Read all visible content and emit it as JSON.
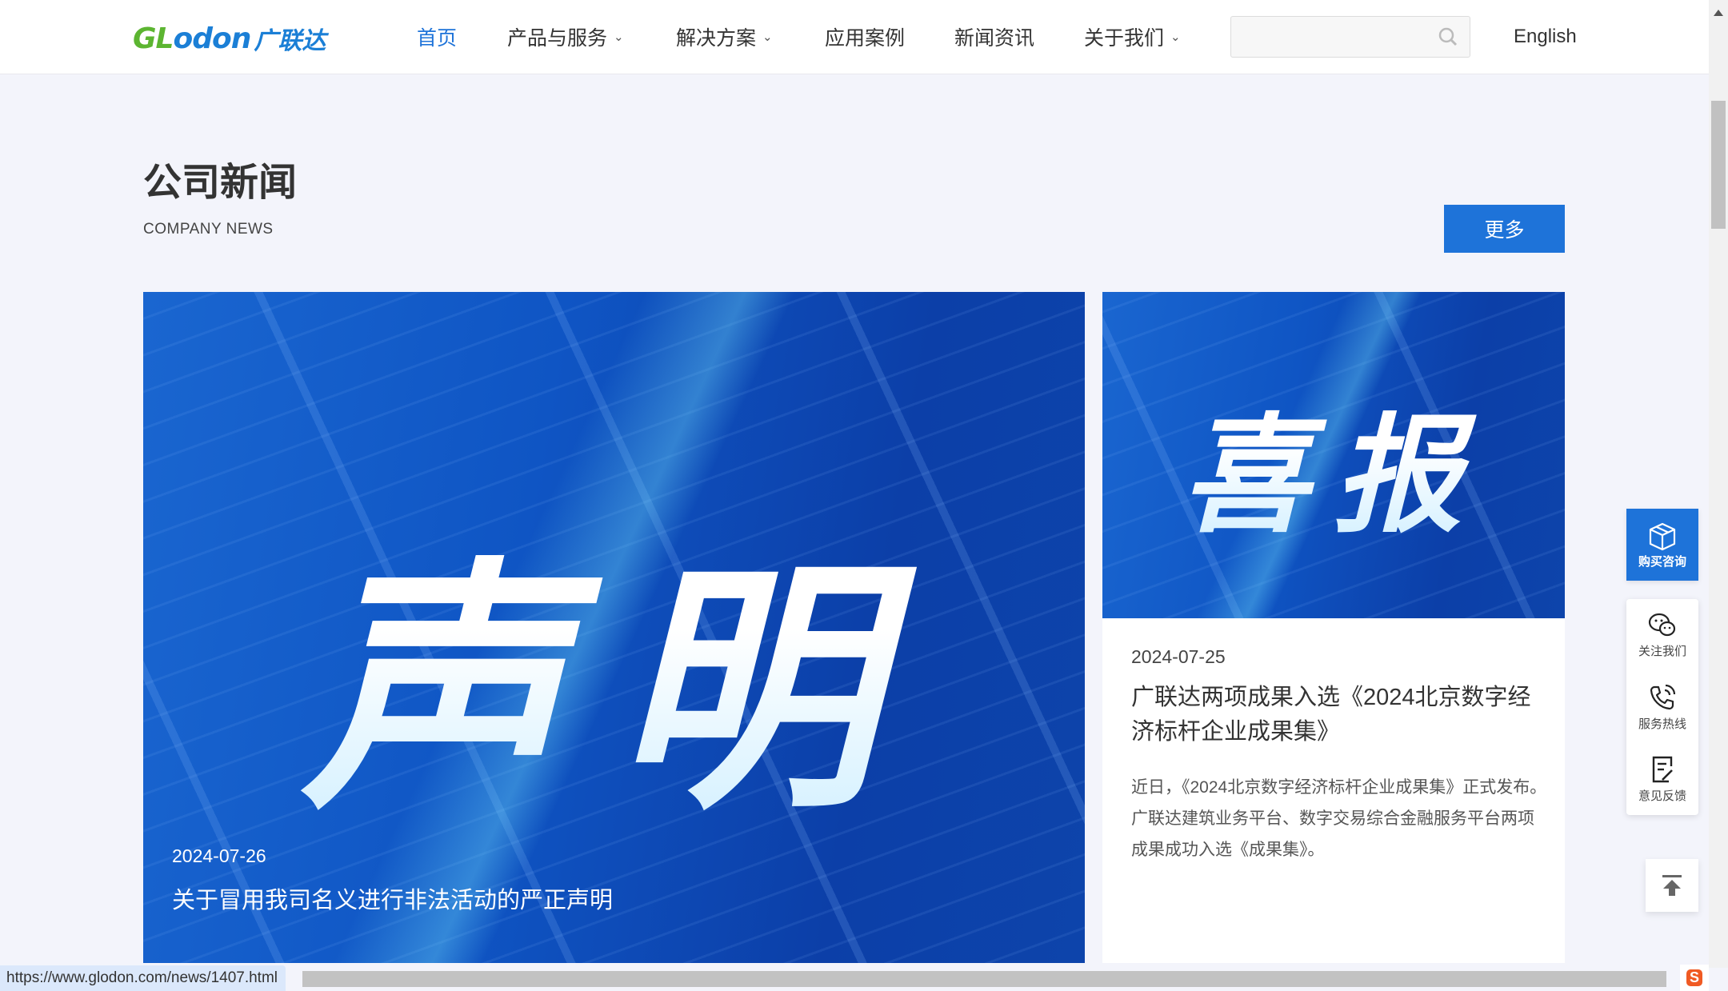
{
  "header": {
    "logo_en_g": "GL",
    "logo_en_b": "odon",
    "logo_cn": "广联达",
    "nav": [
      {
        "label": "首页",
        "active": true,
        "dropdown": false
      },
      {
        "label": "产品与服务",
        "dropdown": true
      },
      {
        "label": "解决方案",
        "dropdown": true
      },
      {
        "label": "应用案例",
        "dropdown": false
      },
      {
        "label": "新闻资讯",
        "dropdown": false
      },
      {
        "label": "关于我们",
        "dropdown": true
      }
    ],
    "chevron": "⌄",
    "search_value": "",
    "search_placeholder": "",
    "language": "English"
  },
  "section": {
    "title": "公司新闻",
    "subtitle": "COMPANY NEWS",
    "more_label": "更多"
  },
  "news": {
    "featured": {
      "banner_text": "声明",
      "date": "2024-07-26",
      "headline": "关于冒用我司名义进行非法活动的严正声明"
    },
    "side": {
      "banner_text": "喜报",
      "date": "2024-07-25",
      "headline": "广联达两项成果入选《2024北京数字经济标杆企业成果集》",
      "summary": "近日，《2024北京数字经济标杆企业成果集》正式发布。广联达建筑业务平台、数字交易综合金融服务平台两项成果成功入选《成果集》。"
    }
  },
  "floating": {
    "buy": "购买咨询",
    "items": [
      "关注我们",
      "服务热线",
      "意见反馈"
    ]
  },
  "status_bar": {
    "url": "https://www.glodon.com/news/1407.html"
  },
  "ime": {
    "label": "S"
  },
  "colors": {
    "accent": "#1e73d9",
    "logo_green": "#5cb531",
    "logo_blue": "#1b7fd6"
  }
}
